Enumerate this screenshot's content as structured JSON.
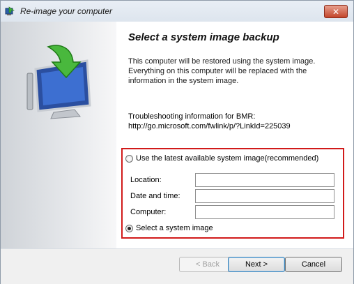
{
  "window": {
    "title": "Re-image your computer",
    "close_label": "✕"
  },
  "main": {
    "heading": "Select a system image backup",
    "description_lines": [
      "This computer will be restored using the system image.",
      "Everything on this computer will be replaced with the",
      "information in the system image."
    ],
    "troubleshooting": {
      "label": "Troubleshooting information for BMR:",
      "url": "http://go.microsoft.com/fwlink/p/?LinkId=225039"
    },
    "options": {
      "latest_label": "Use the latest available system image(recommended)",
      "latest_selected": false,
      "select_label": "Select a system image",
      "select_selected": true
    },
    "fields": {
      "location_label": "Location:",
      "location_value": "",
      "date_label": "Date and time:",
      "date_value": "",
      "computer_label": "Computer:",
      "computer_value": ""
    }
  },
  "footer": {
    "back_label": "< Back",
    "next_label": "Next >",
    "cancel_label": "Cancel"
  },
  "colors": {
    "highlight_border": "#d11a1a",
    "titlebar": "#dde5ee",
    "close_button": "#c2452b"
  },
  "icons": {
    "title": "restore-app-icon",
    "hero": "computer-restore-arrow-icon"
  }
}
